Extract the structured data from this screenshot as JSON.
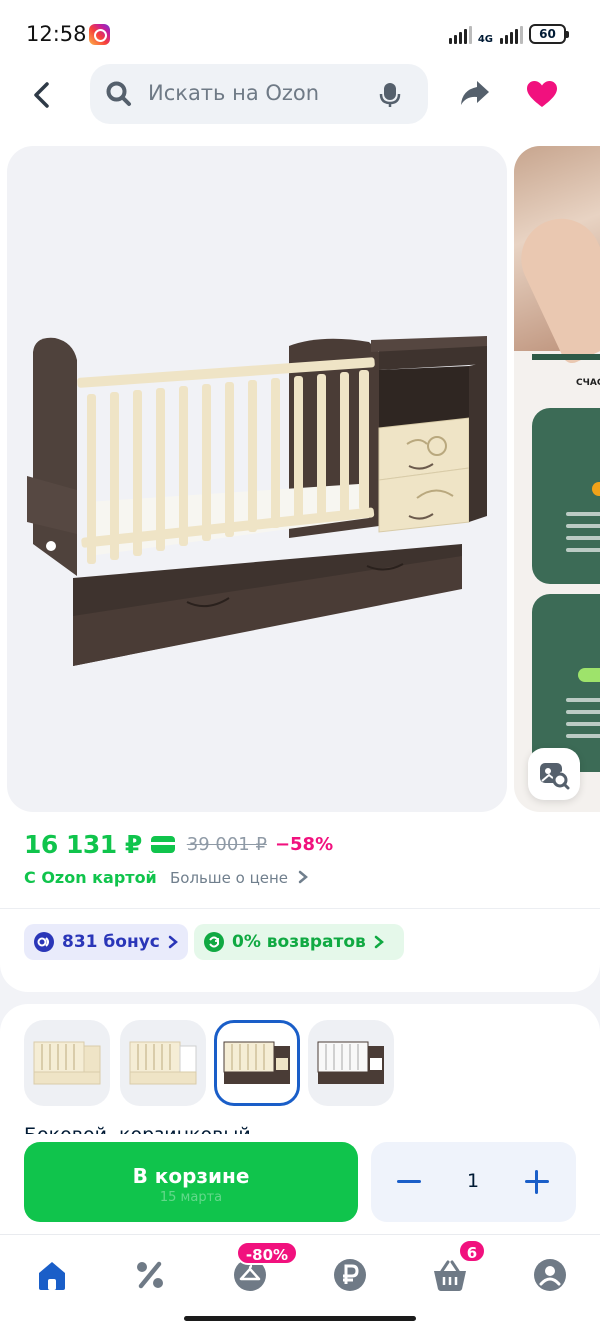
{
  "status_bar": {
    "time": "12:58",
    "network": "4G",
    "battery": "60"
  },
  "search": {
    "placeholder": "Искать на Ozon"
  },
  "product": {
    "price": "16 131 ₽",
    "old_price": "39 001 ₽",
    "discount": "−58%",
    "card_label": "С Ozon картой",
    "more_price_label": "Больше о цене",
    "bonus_chip": "831 бонус",
    "return_chip": "0% возвратов",
    "title_peek": "Боковой, корзинковый"
  },
  "slide2": {
    "caption": "СЧАС"
  },
  "variants": [
    {
      "name": "cream-cream",
      "selected": false
    },
    {
      "name": "cream-white",
      "selected": false
    },
    {
      "name": "wenge-cream",
      "selected": true
    },
    {
      "name": "wenge-white",
      "selected": false
    }
  ],
  "cart": {
    "button_label": "В корзине",
    "delivery_hint": "15 марта",
    "quantity": "1"
  },
  "bottom_nav": {
    "items": [
      "home-icon",
      "percent-icon",
      "hanger-icon",
      "ruble-icon",
      "basket-icon",
      "profile-icon"
    ],
    "fresh_badge": "-80%",
    "cart_badge": "6"
  },
  "colors": {
    "green": "#10c44c",
    "pink": "#f1117e",
    "blue": "#1a5ec8",
    "wenge": "#4a3c36",
    "cream": "#efe4c6"
  }
}
